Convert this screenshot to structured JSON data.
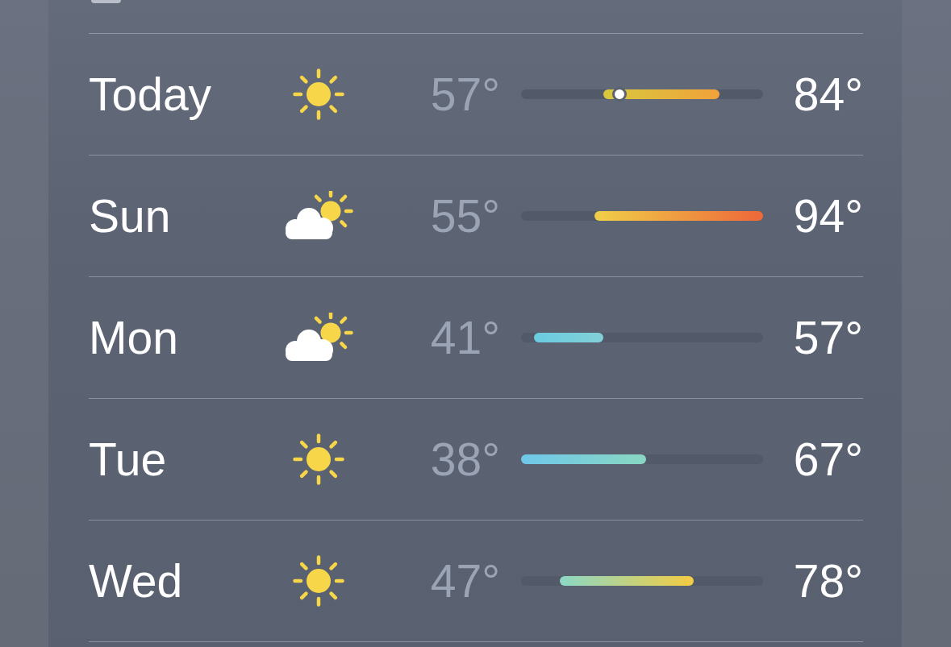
{
  "days": [
    {
      "day": "Today",
      "kind": "sun",
      "low": "57°",
      "high": "84°",
      "range": {
        "start": {
          "color": "#d8c63e"
        },
        "end": {
          "color": "#f0a43a"
        }
      },
      "current": {
        "level": 0.407
      }
    },
    {
      "day": "Sun",
      "kind": "suncloud",
      "low": "55°",
      "high": "94°",
      "range": {
        "start": {
          "color": "#f0cc48"
        },
        "end": {
          "color": "#ee6a3a"
        }
      }
    },
    {
      "day": "Mon",
      "kind": "suncloud",
      "low": "41°",
      "high": "57°",
      "range": {
        "start": {
          "color": "#6ccce0"
        },
        "end": {
          "color": "#80d0d8"
        }
      }
    },
    {
      "day": "Tue",
      "kind": "sun",
      "low": "38°",
      "high": "67°",
      "range": {
        "start": {
          "color": "#70c8e8"
        },
        "end": {
          "color": "#88d6c4"
        }
      }
    },
    {
      "day": "Wed",
      "kind": "sun",
      "low": "47°",
      "high": "78°",
      "range": {
        "start": {
          "color": "#90d8c0"
        },
        "end": {
          "color": "#f0cc48"
        }
      }
    }
  ]
}
